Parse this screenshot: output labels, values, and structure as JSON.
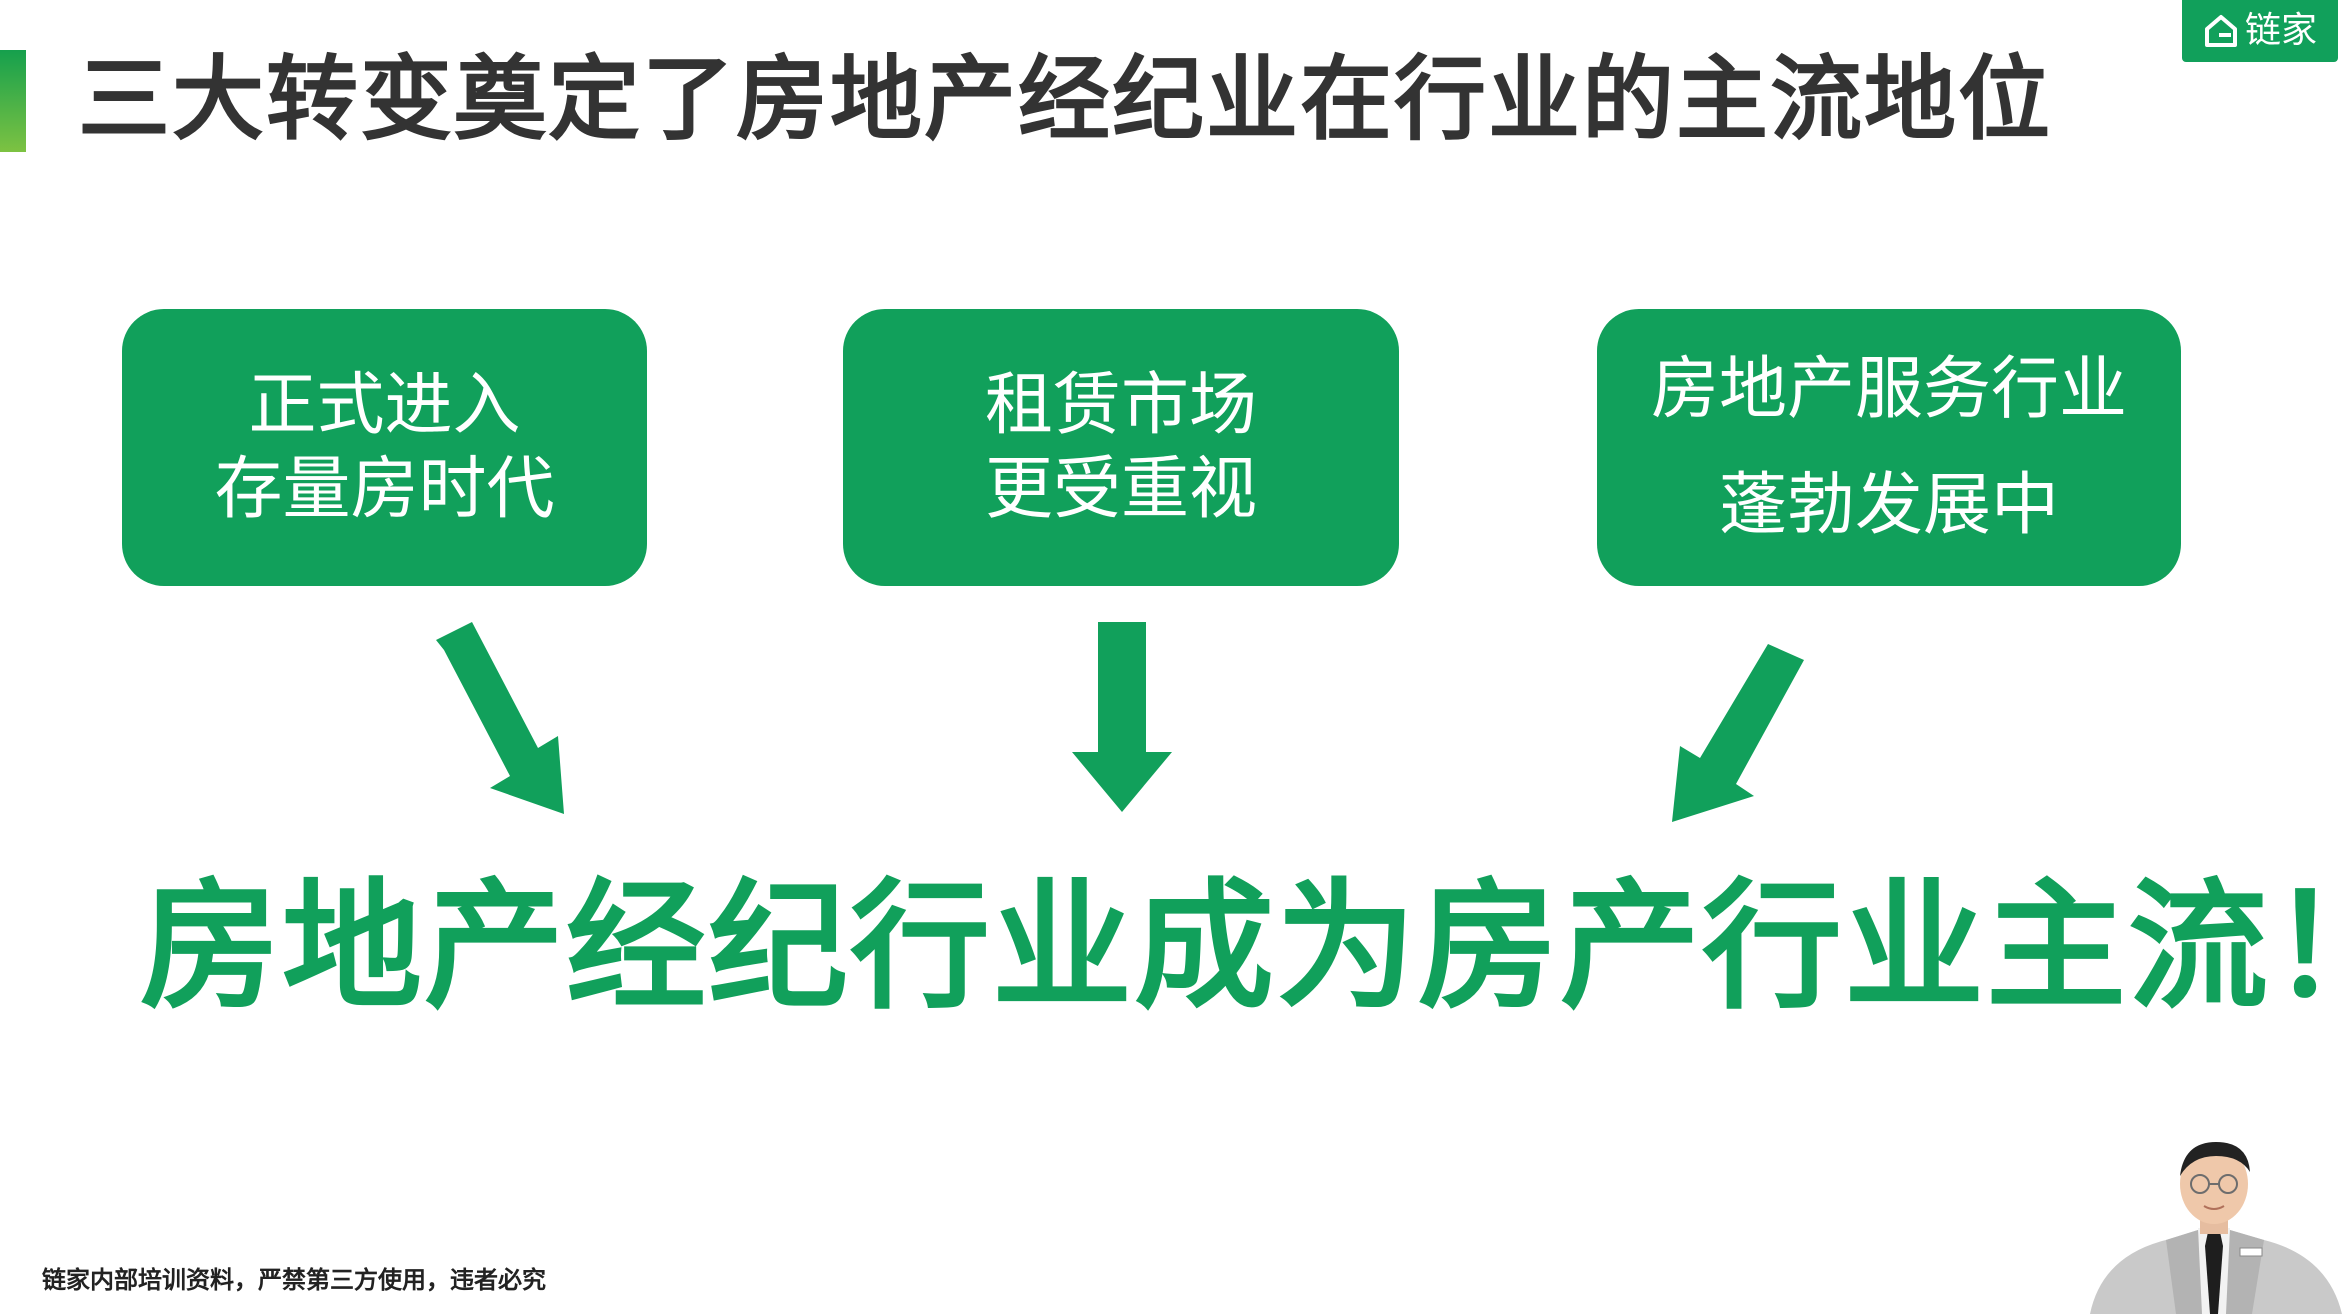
{
  "slide": {
    "title": "三大转变奠定了房地产经纪业在行业的主流地位",
    "logo": {
      "text": "链家",
      "icon": "house-icon"
    },
    "cards": [
      {
        "line1": "正式进入",
        "line2": "存量房时代"
      },
      {
        "line1": "租赁市场",
        "line2": "更受重视"
      },
      {
        "line1": "房地产服务行业",
        "line2": "蓬勃发展中"
      }
    ],
    "arrows": [
      "arrow-down-right-icon",
      "arrow-down-icon",
      "arrow-down-left-icon"
    ],
    "headline": "房地产经纪行业成为房产行业主流！",
    "footer_note": "链家内部培训资料，严禁第三方使用，违者必究"
  },
  "colors": {
    "brand_green": "#11a05b",
    "accent_light_green": "#7dc242",
    "title_text": "#333333",
    "background": "#ffffff"
  }
}
